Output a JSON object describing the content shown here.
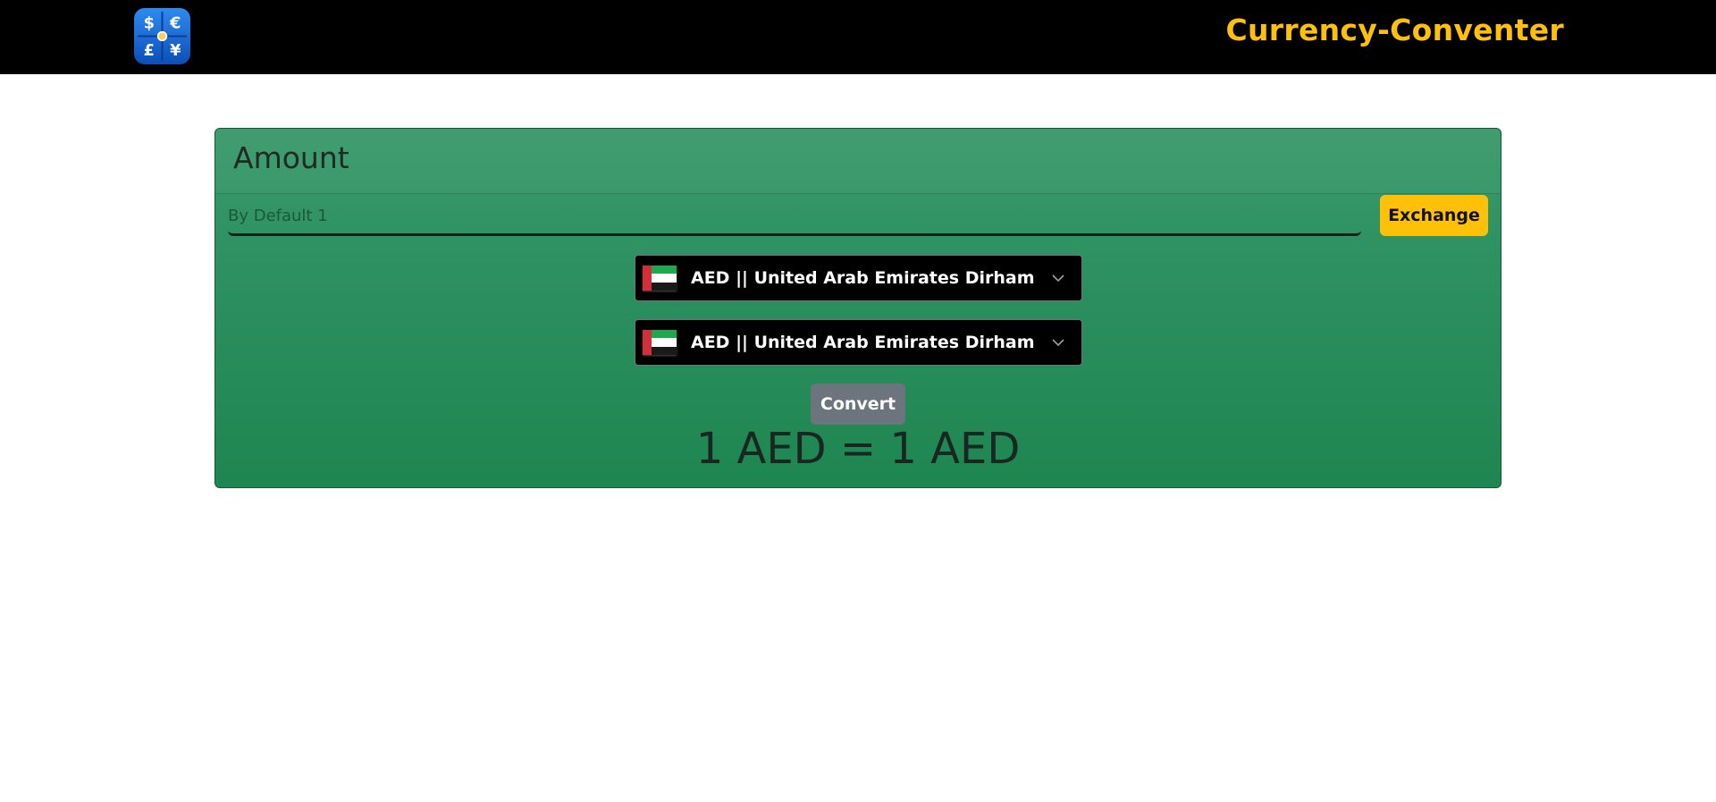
{
  "header": {
    "brand_title": "Currency-Conventer",
    "logo_icon": "currency-symbols-icon",
    "logo_symbols": [
      "$",
      "€",
      "£",
      "¥"
    ]
  },
  "card": {
    "title": "Amount",
    "amount_placeholder": "By Default 1",
    "amount_value": "",
    "exchange_label": "Exchange",
    "from_select": {
      "flag_icon": "uae-flag-icon",
      "label": "AED || United Arab Emirates Dirham"
    },
    "to_select": {
      "flag_icon": "uae-flag-icon",
      "label": "AED || United Arab Emirates Dirham"
    },
    "convert_label": "Convert",
    "result_text": "1 AED = 1 AED"
  },
  "colors": {
    "topbar": "#000000",
    "brand": "#ffc107",
    "card_green": "#2c9060",
    "exchange_button": "#ffc107",
    "convert_button": "#6c757d"
  }
}
